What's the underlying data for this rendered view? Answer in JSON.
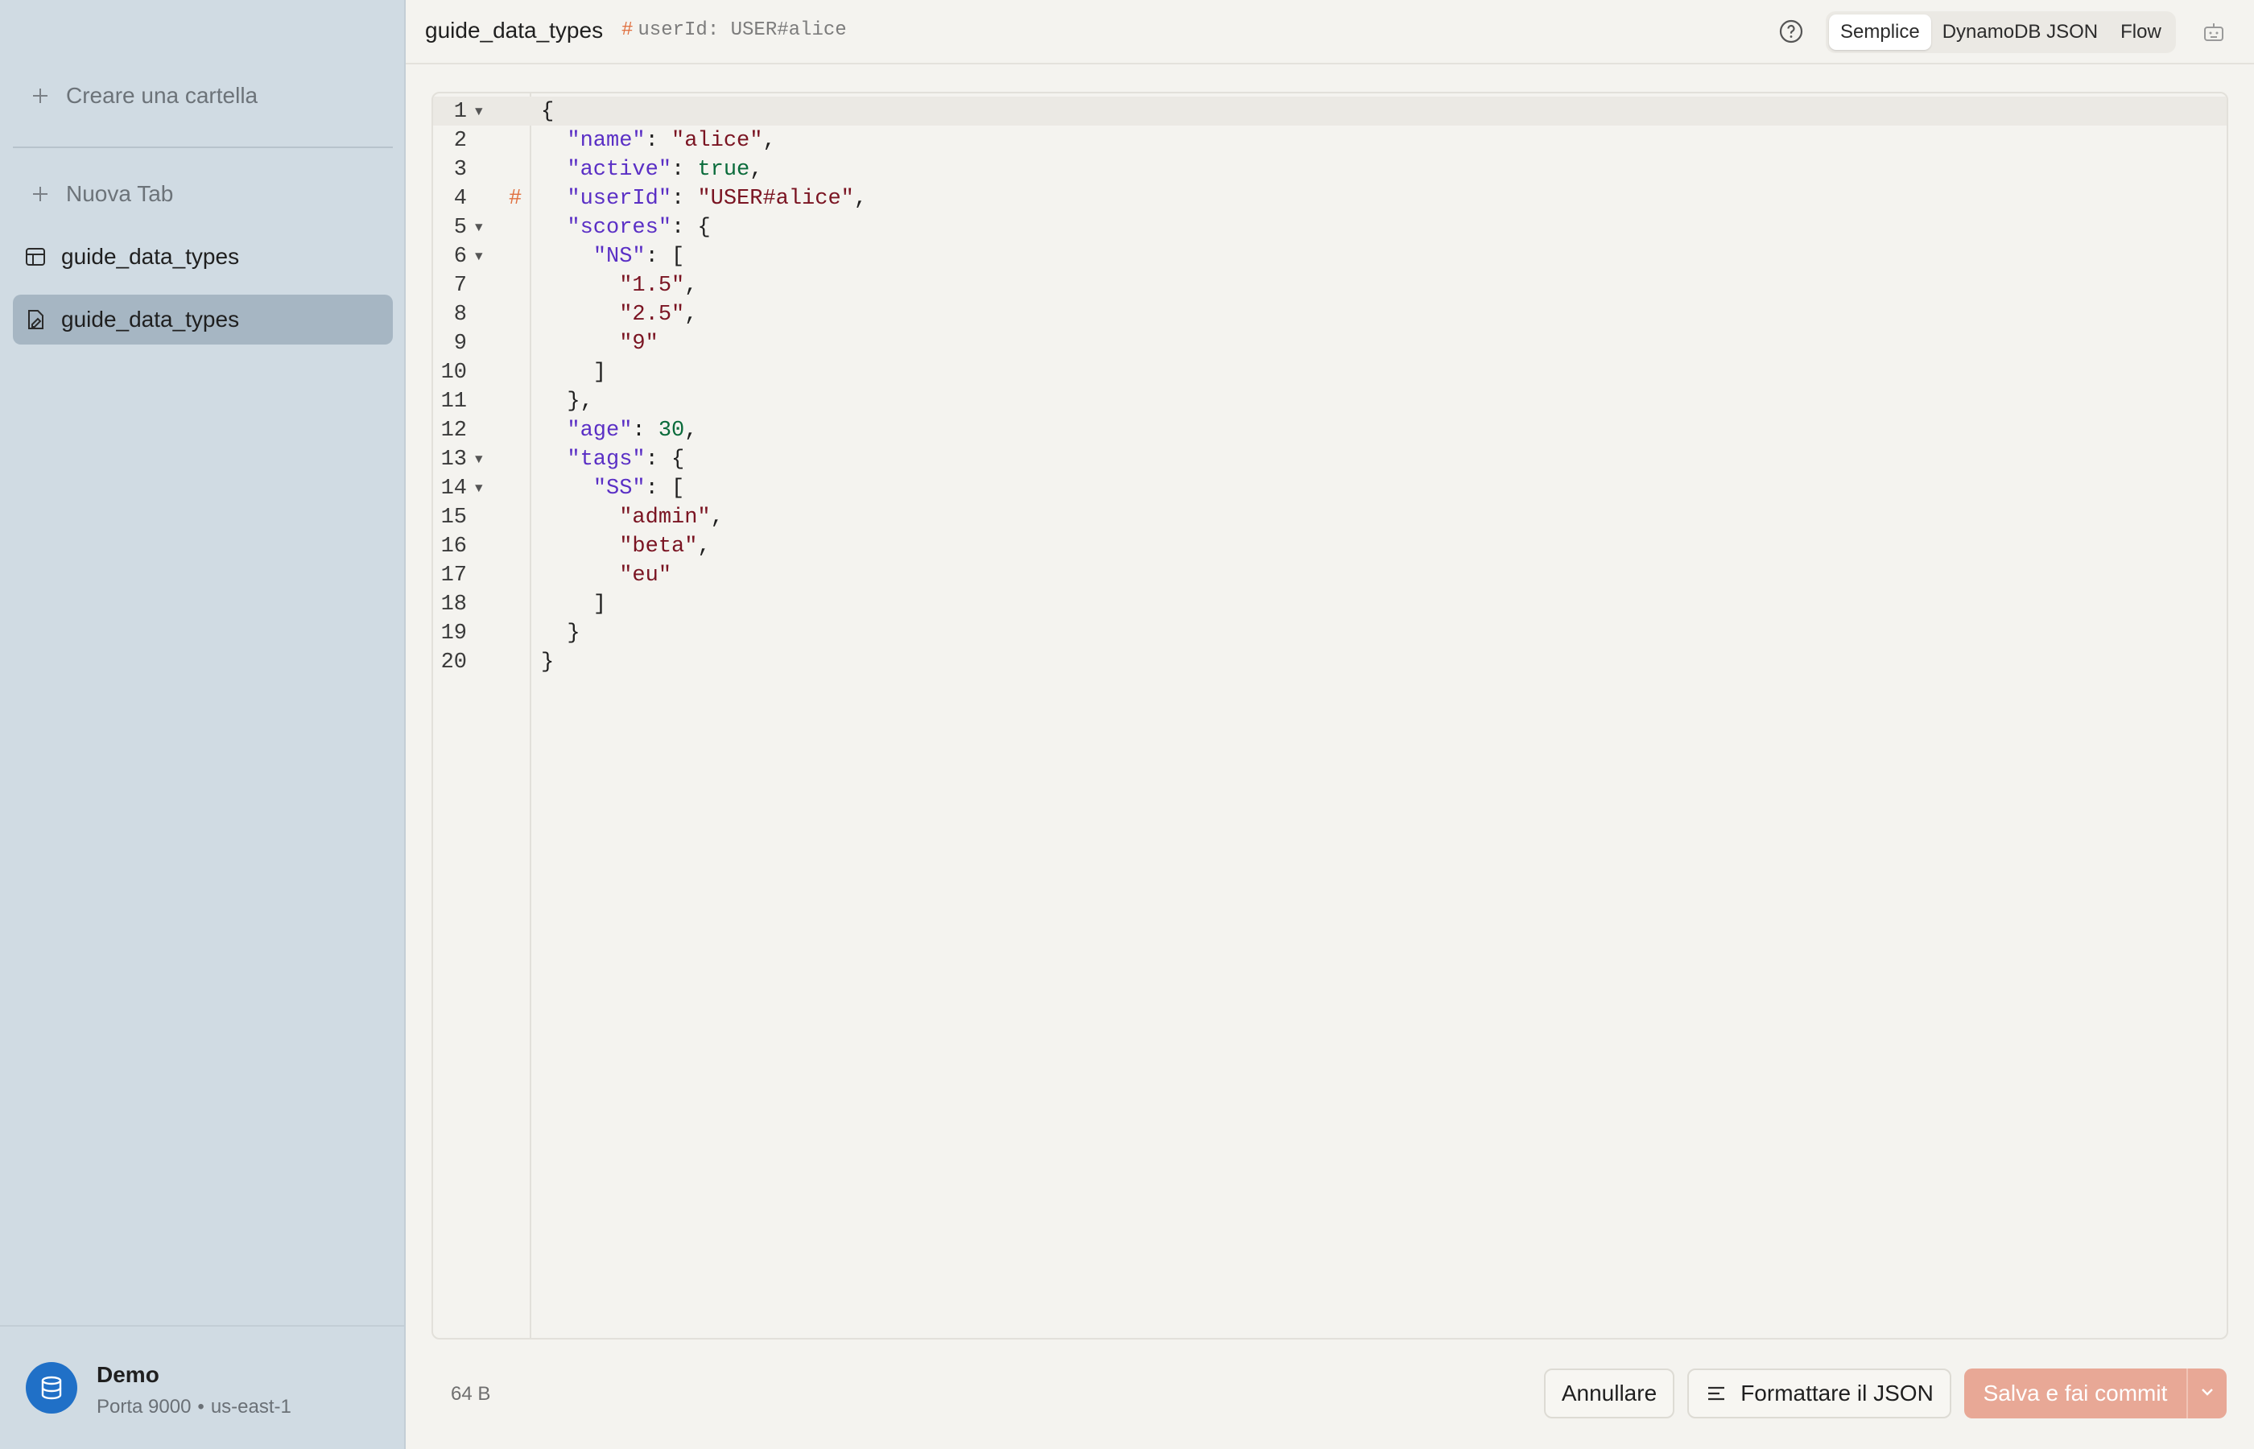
{
  "sidebar": {
    "new_folder_label": "Creare una cartella",
    "new_tab_label": "Nuova Tab",
    "items": [
      {
        "label": "guide_data_types",
        "icon": "table-icon"
      },
      {
        "label": "guide_data_types",
        "icon": "document-edit-icon"
      }
    ],
    "connection": {
      "name": "Demo",
      "port": "Porta 9000",
      "separator": "•",
      "region": "us-east-1"
    }
  },
  "header": {
    "title": "guide_data_types",
    "key_hash": "#",
    "key_text": "userId: USER#alice",
    "view_modes": [
      "Semplice",
      "DynamoDB JSON",
      "Flow"
    ],
    "selected_mode": "Semplice"
  },
  "editor": {
    "line_numbers": [
      "1",
      "2",
      "3",
      "4",
      "5",
      "6",
      "7",
      "8",
      "9",
      "10",
      "11",
      "12",
      "13",
      "14",
      "15",
      "16",
      "17",
      "18",
      "19",
      "20"
    ],
    "key_marker": "#",
    "tokens": {
      "open_brace": "{",
      "close_brace": "}",
      "open_bracket": "[",
      "close_bracket": "]",
      "close_brace_comma": "},",
      "colon": ": ",
      "comma": ",",
      "name_key": "\"name\"",
      "name_val": "\"alice\"",
      "active_key": "\"active\"",
      "active_val": "true",
      "userid_key": "\"userId\"",
      "userid_val": "\"USER#alice\"",
      "scores_key": "\"scores\"",
      "ns_key": "\"NS\"",
      "ns_1": "\"1.5\"",
      "ns_2": "\"2.5\"",
      "ns_3": "\"9\"",
      "age_key": "\"age\"",
      "age_val": "30",
      "tags_key": "\"tags\"",
      "ss_key": "\"SS\"",
      "ss_1": "\"admin\"",
      "ss_2": "\"beta\"",
      "ss_3": "\"eu\""
    }
  },
  "footer": {
    "size": "64 B",
    "cancel_label": "Annullare",
    "format_label": "Formattare il JSON",
    "save_label": "Salva e fai commit"
  },
  "colors": {
    "accent": "#e8a896",
    "key_marker": "#e07040",
    "json_key": "#5a2fc5",
    "json_string": "#7a1422",
    "json_literal": "#0a6b3b",
    "sidebar_bg": "#d0dbe3",
    "avatar": "#2070c7"
  }
}
